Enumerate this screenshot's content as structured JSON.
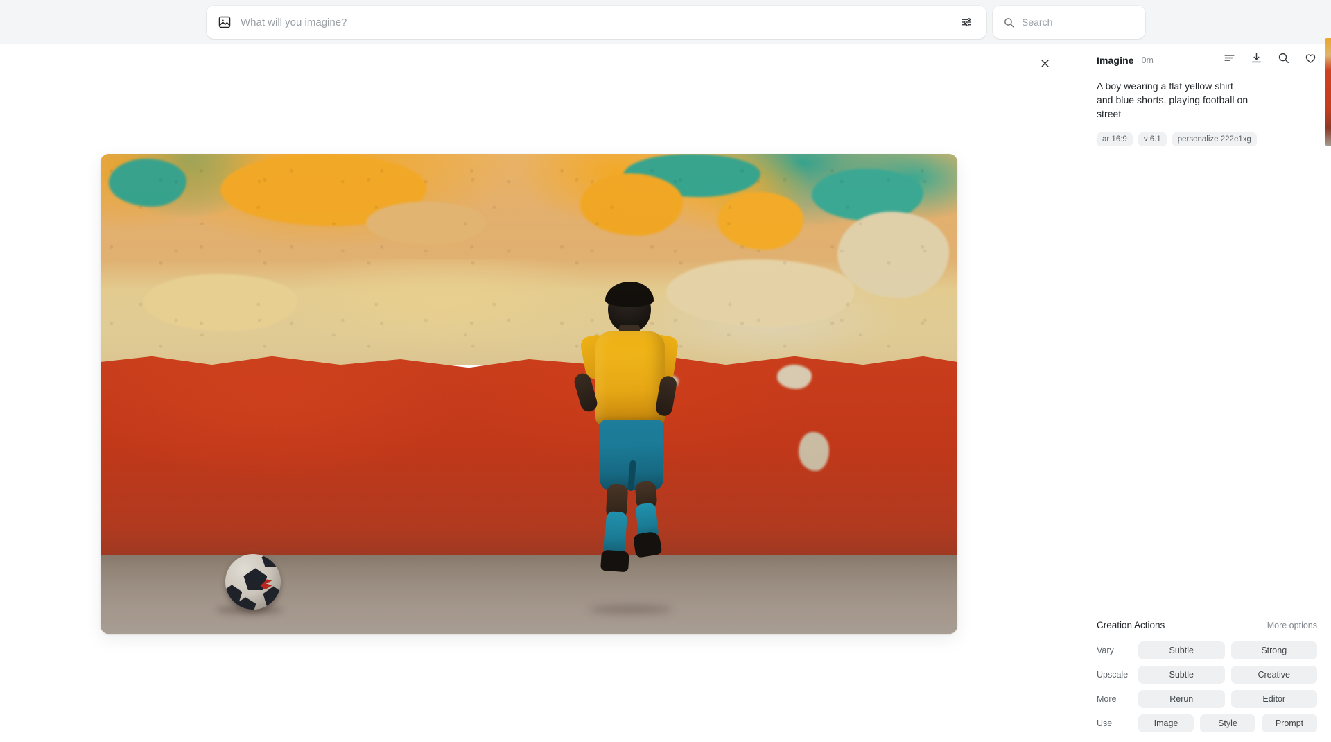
{
  "app": {
    "background_color": "#ffffff",
    "topbar_color": "#f4f5f6"
  },
  "topbar": {
    "prompt": {
      "icon": "image-icon",
      "value": "",
      "placeholder": "What will you imagine?",
      "settings_icon": "sliders-icon"
    },
    "search": {
      "icon": "search-icon",
      "value": "",
      "placeholder": "Search"
    }
  },
  "modal": {
    "close_icon": "close-icon"
  },
  "image_view": {
    "alt": "A boy in a yellow shirt and blue shorts running toward a football beside a weathered orange, cream and red painted wall on a street",
    "aspect_ratio": "16:9"
  },
  "panel": {
    "header": {
      "title": "Imagine",
      "age": "0m",
      "icons": [
        {
          "name": "list-lines-icon",
          "label": "Details"
        },
        {
          "name": "download-icon",
          "label": "Download"
        },
        {
          "name": "search-zoom-icon",
          "label": "Search"
        },
        {
          "name": "heart-icon",
          "label": "Favorite"
        }
      ]
    },
    "prompt_text": "A boy wearing a flat yellow shirt and blue shorts, playing football on street",
    "tags": [
      "ar 16:9",
      "v 6.1",
      "personalize 222e1xg"
    ],
    "creation_actions": {
      "title": "Creation Actions",
      "more_options": "More options",
      "rows": [
        {
          "label": "Vary",
          "buttons": [
            "Subtle",
            "Strong"
          ]
        },
        {
          "label": "Upscale",
          "buttons": [
            "Subtle",
            "Creative"
          ]
        },
        {
          "label": "More",
          "buttons": [
            "Rerun",
            "Editor"
          ]
        },
        {
          "label": "Use",
          "buttons": [
            "Image",
            "Style",
            "Prompt"
          ]
        }
      ]
    }
  }
}
